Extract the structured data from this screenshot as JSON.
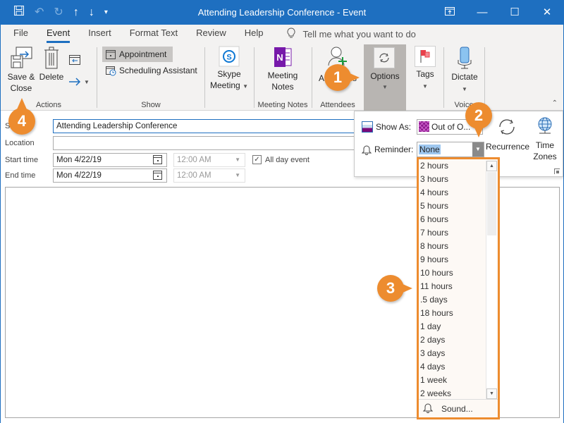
{
  "window": {
    "title": "Attending Leadership Conference  -  Event",
    "controls": {
      "ribbon_display": "⬓",
      "minimize": "—",
      "maximize": "☐",
      "close": "✕"
    }
  },
  "qat": {
    "save_icon": "💾",
    "undo_icon": "↶",
    "redo_icon": "↻",
    "up_icon": "↑",
    "down_icon": "↓",
    "customize_icon": "▾"
  },
  "tabs": [
    {
      "label": "File",
      "active": false
    },
    {
      "label": "Event",
      "active": true
    },
    {
      "label": "Insert",
      "active": false
    },
    {
      "label": "Format Text",
      "active": false
    },
    {
      "label": "Review",
      "active": false
    },
    {
      "label": "Help",
      "active": false
    }
  ],
  "tell_me": {
    "icon": "lightbulb",
    "placeholder": "Tell me what you want to do"
  },
  "ribbon": {
    "actions": {
      "label": "Actions",
      "save_close": "Save &\nClose",
      "save_close_line1": "Save &",
      "save_close_line2": "Close",
      "delete": "Delete"
    },
    "show": {
      "label": "Show",
      "appointment": "Appointment",
      "scheduling_assistant": "Scheduling Assistant"
    },
    "skype": {
      "line1": "Skype",
      "line2": "Meeting"
    },
    "meeting_notes": {
      "label": "Meeting Notes",
      "line1": "Meeting",
      "line2": "Notes"
    },
    "attendees": {
      "label": "Attendees",
      "button": "Attendees"
    },
    "options": {
      "button": "Options"
    },
    "tags": {
      "button": "Tags"
    },
    "voice": {
      "label": "Voice",
      "button": "Dictate"
    }
  },
  "form": {
    "subject_label": "Subject",
    "subject_value": "Attending Leadership Conference",
    "location_label": "Location",
    "location_value": "",
    "start_label": "Start time",
    "start_date": "Mon 4/22/19",
    "start_time": "12:00 AM",
    "all_day_label": "All day event",
    "all_day_checked": true,
    "end_label": "End time",
    "end_date": "Mon 4/22/19",
    "end_time": "12:00 AM"
  },
  "options_flyout": {
    "show_as_label": "Show As:",
    "show_as_value": "Out of O...",
    "reminder_label": "Reminder:",
    "reminder_value": "None",
    "recurrence": "Recurrence",
    "time_zones_line1": "Time",
    "time_zones_line2": "Zones"
  },
  "reminder_list": {
    "items": [
      "2 hours",
      "3 hours",
      "4 hours",
      "5 hours",
      "6 hours",
      "7 hours",
      "8 hours",
      "9 hours",
      "10 hours",
      "11 hours",
      ".5 days",
      "18 hours",
      "1 day",
      "2 days",
      "3 days",
      "4 days",
      "1 week",
      "2 weeks"
    ],
    "sound": "Sound..."
  },
  "callouts": [
    "1",
    "2",
    "3",
    "4"
  ],
  "colors": {
    "accent": "#1e6fc0",
    "callout": "#ed8c2f",
    "ribbon_bg": "#f3f2f1",
    "selection": "#9ec7ef"
  }
}
